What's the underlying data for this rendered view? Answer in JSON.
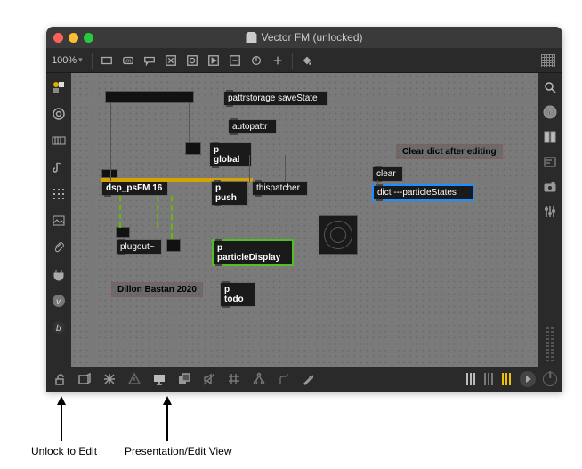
{
  "window": {
    "title": "Vector FM (unlocked)",
    "zoom": "100%"
  },
  "objects": {
    "pattrstorage": "pattrstorage saveState",
    "autopattr": "autopattr",
    "pglobal": "p global",
    "dsp": "dsp_psFM 16",
    "ppush": "p push",
    "thispatcher": "thispatcher",
    "clear": "clear",
    "dict": "dict ---particleStates",
    "plugout": "plugout~",
    "pparticle": "p particleDisplay",
    "ptodo": "p todo"
  },
  "comments": {
    "clearDict": "Clear dict after editing",
    "author": "Dillon Bastan 2020"
  },
  "annotations": {
    "unlock": "Unlock to Edit",
    "presentation": "Presentation/Edit View"
  }
}
